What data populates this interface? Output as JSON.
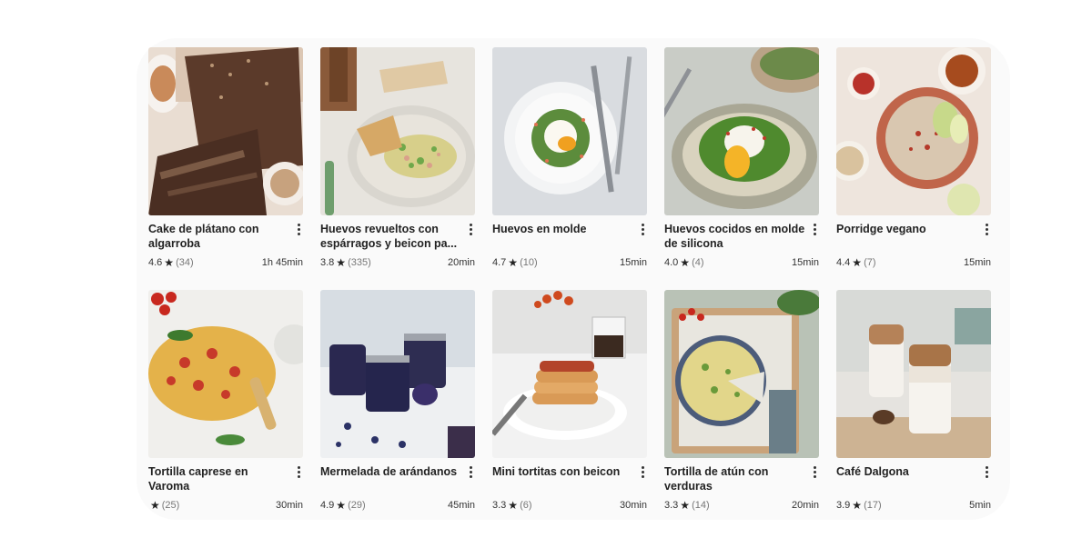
{
  "recipes": [
    {
      "title": "Cake de plátano con algarroba",
      "rating": "4.6",
      "count": "(34)",
      "time": "1h 45min",
      "bg": "#e9ddd2"
    },
    {
      "title": "Huevos revueltos con espárragos y beicon pa...",
      "rating": "3.8",
      "count": "(335)",
      "time": "20min",
      "bg": "#e7e4de"
    },
    {
      "title": "Huevos en molde",
      "rating": "4.7",
      "count": "(10)",
      "time": "15min",
      "bg": "#d9dce0"
    },
    {
      "title": "Huevos cocidos en molde de silicona",
      "rating": "4.0",
      "count": "(4)",
      "time": "15min",
      "bg": "#c9ccc6"
    },
    {
      "title": "Porridge vegano",
      "rating": "4.4",
      "count": "(7)",
      "time": "15min",
      "bg": "#eee5dd"
    },
    {
      "title": "Tortilla caprese en Varoma",
      "rating": "",
      "count": "(25)",
      "time": "30min",
      "bg": "#f0efec"
    },
    {
      "title": "Mermelada de arándanos",
      "rating": "4.9",
      "count": "(29)",
      "time": "45min",
      "bg": "#eef0f2"
    },
    {
      "title": "Mini tortitas con beicon",
      "rating": "3.3",
      "count": "(6)",
      "time": "30min",
      "bg": "#f2f2f2"
    },
    {
      "title": "Tortilla de atún con verduras",
      "rating": "3.3",
      "count": "(14)",
      "time": "20min",
      "bg": "#b9c2b6"
    },
    {
      "title": "Café Dalgona",
      "rating": "3.9",
      "count": "(17)",
      "time": "5min",
      "bg": "#e5e3df"
    }
  ],
  "icons": {
    "rating": "star-icon",
    "menu": "more-vertical-icon"
  }
}
